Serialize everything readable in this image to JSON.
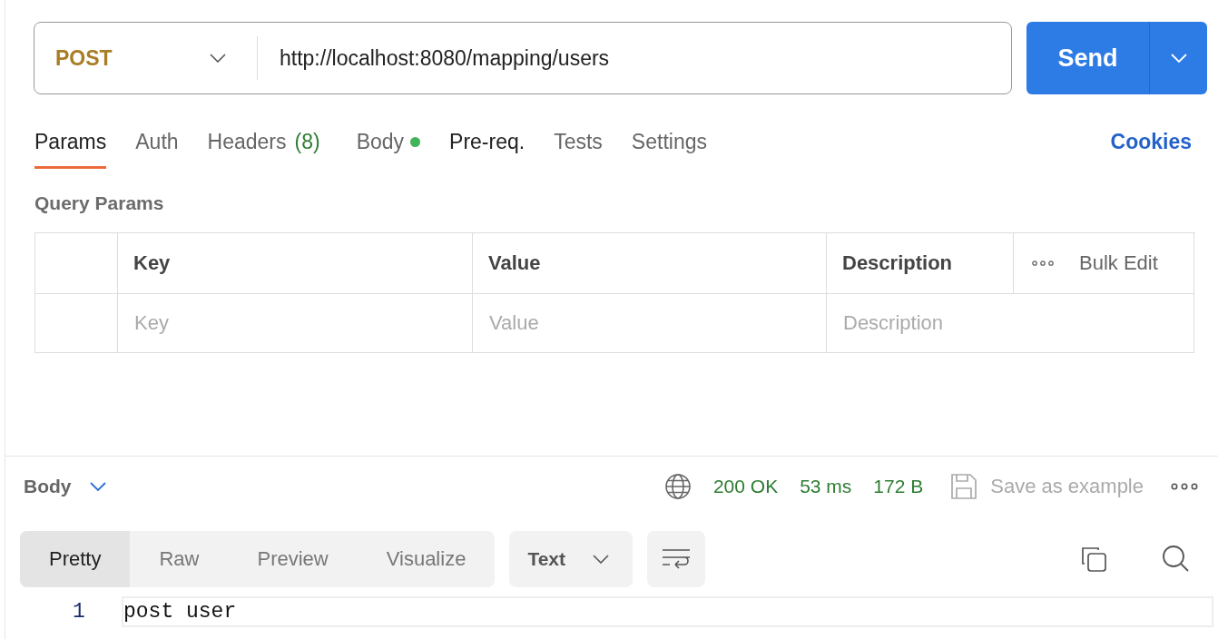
{
  "request": {
    "method": "POST",
    "url": "http://localhost:8080/mapping/users",
    "send": "Send"
  },
  "tabs": [
    {
      "label": "Params",
      "selected": true,
      "highlighted": true
    },
    {
      "label": "Auth",
      "selected": false,
      "highlighted": false
    },
    {
      "label": "Headers",
      "count": "(8)",
      "selected": false,
      "highlighted": false
    },
    {
      "label": "Body",
      "dot": true,
      "selected": false,
      "highlighted": false
    },
    {
      "label": "Pre-req.",
      "selected": false,
      "highlighted": true
    },
    {
      "label": "Tests",
      "selected": false,
      "highlighted": false
    },
    {
      "label": "Settings",
      "selected": false,
      "highlighted": false
    }
  ],
  "cookies": "Cookies",
  "query_params": {
    "title": "Query Params",
    "columns": [
      "Key",
      "Value",
      "Description"
    ],
    "bulk_edit": "Bulk Edit",
    "rows": [
      {
        "key_placeholder": "Key",
        "value_placeholder": "Value",
        "description_placeholder": "Description"
      }
    ]
  },
  "response": {
    "section": "Body",
    "status": "200 OK",
    "time": "53 ms",
    "size": "172 B",
    "save": "Save as example",
    "views": [
      {
        "label": "Pretty",
        "selected": true
      },
      {
        "label": "Raw",
        "selected": false
      },
      {
        "label": "Preview",
        "selected": false
      },
      {
        "label": "Visualize",
        "selected": false
      }
    ],
    "format": "Text",
    "lines": [
      {
        "number": "1",
        "text": "post user"
      }
    ]
  }
}
